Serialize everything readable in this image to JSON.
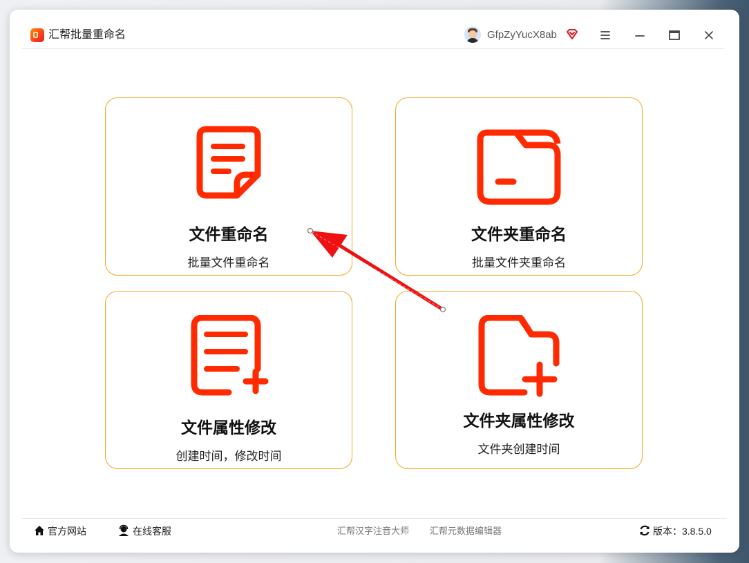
{
  "app": {
    "title": "汇帮批量重命名"
  },
  "user": {
    "name": "GfpZyYucX8ab"
  },
  "window_controls": {
    "menu": "menu-icon",
    "minimize": "minimize-icon",
    "maximize": "maximize-icon",
    "close": "close-icon"
  },
  "cards": [
    {
      "title": "文件重命名",
      "subtitle": "批量文件重命名",
      "icon": "file-document-icon"
    },
    {
      "title": "文件夹重命名",
      "subtitle": "批量文件夹重命名",
      "icon": "folder-icon"
    },
    {
      "title": "文件属性修改",
      "subtitle": "创建时间，修改时间",
      "icon": "file-add-icon"
    },
    {
      "title": "文件夹属性修改",
      "subtitle": "文件夹创建时间",
      "icon": "folder-add-icon"
    }
  ],
  "footer": {
    "website": "官方网站",
    "support": "在线客服",
    "link1": "汇帮汉字注音大师",
    "link2": "汇帮元数据编辑器",
    "version": "版本：3.8.5.0"
  },
  "colors": {
    "accent_icon": "#ff2a00",
    "card_border": "#f5a623",
    "annotation_arrow": "#ee1111"
  }
}
